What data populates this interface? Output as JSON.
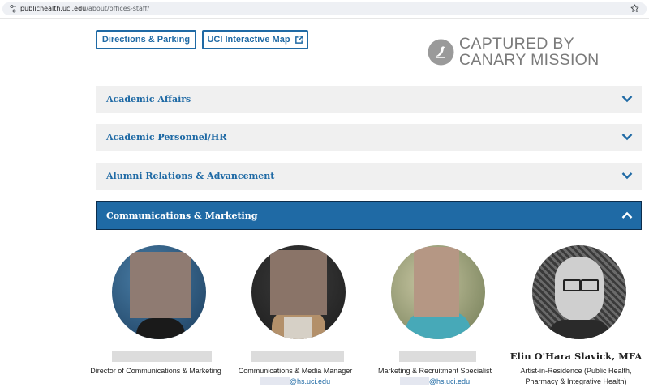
{
  "browser": {
    "url_host": "publichealth.uci.edu",
    "url_path": "/about/offices-staff/"
  },
  "buttons": {
    "directions": "Directions & Parking",
    "map": "UCI Interactive Map"
  },
  "watermark": {
    "line1": "CAPTURED BY",
    "line2": "CANARY MISSION"
  },
  "accordion": [
    {
      "label": "Academic Affairs",
      "expanded": false
    },
    {
      "label": "Academic Personnel/HR",
      "expanded": false
    },
    {
      "label": "Alumni Relations & Advancement",
      "expanded": false
    },
    {
      "label": "Communications & Marketing",
      "expanded": true
    }
  ],
  "staff": [
    {
      "name": "",
      "role": "Director of Communications & Marketing",
      "email_domain": ""
    },
    {
      "name": "",
      "role": "Communications & Media Manager",
      "email_domain": "@hs.uci.edu"
    },
    {
      "name": "",
      "role": "Marketing & Recruitment Specialist",
      "email_domain": "@hs.uci.edu"
    },
    {
      "name": "Elin O'Hara Slavick, MFA",
      "role": "Artist-in-Residence (Public Health, Pharmacy & Integrative Health)",
      "email_domain": ""
    }
  ],
  "colors": {
    "accent": "#1f6aa5",
    "panel": "#f0f0f0",
    "watermark": "#7a7a7a"
  }
}
